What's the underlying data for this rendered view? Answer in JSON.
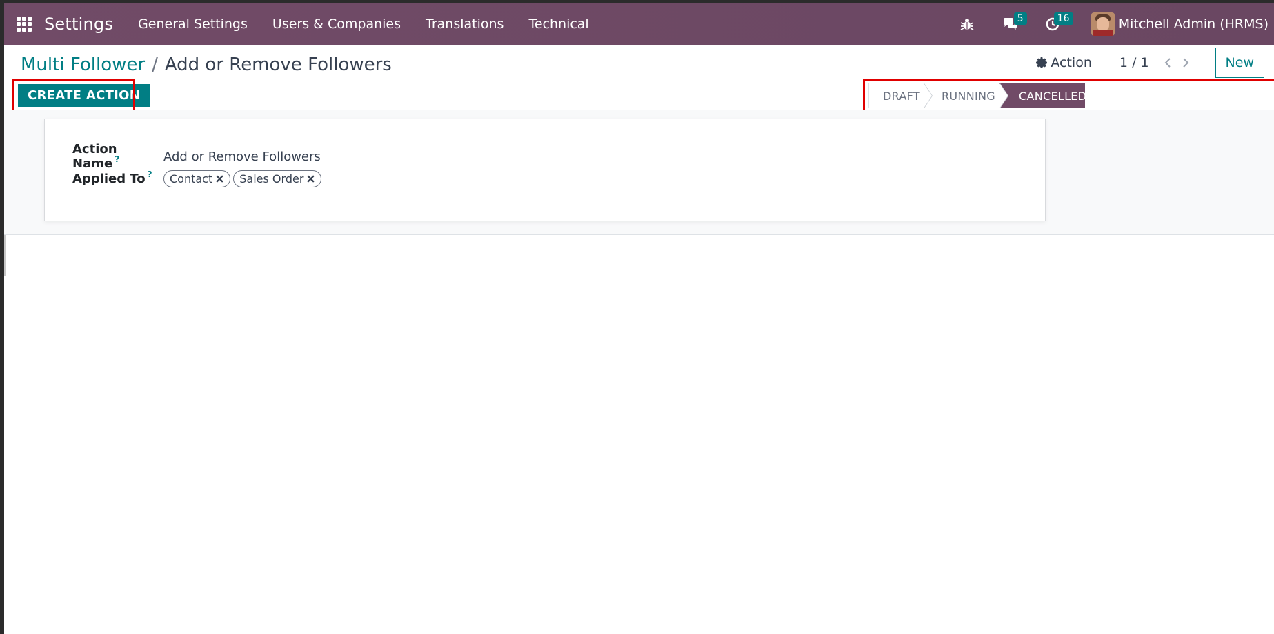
{
  "navbar": {
    "app_name": "Settings",
    "menu": [
      "General Settings",
      "Users & Companies",
      "Translations",
      "Technical"
    ],
    "messages_count": "5",
    "activities_count": "16",
    "user_name": "Mitchell Admin (HRMS)"
  },
  "breadcrumb": {
    "parent": "Multi Follower",
    "separator": "/",
    "current": "Add or Remove Followers"
  },
  "control": {
    "action_label": "Action",
    "pager": "1 / 1",
    "new_label": "New"
  },
  "statusbar": {
    "create_action_label": "CREATE ACTION",
    "stages": [
      "DRAFT",
      "RUNNING",
      "CANCELLED"
    ],
    "active_stage": "CANCELLED"
  },
  "form": {
    "action_name_label": "Action Name",
    "action_name_value": "Add or Remove Followers",
    "applied_to_label": "Applied To",
    "help_mark": "?",
    "applied_to_tags": [
      "Contact",
      "Sales Order"
    ]
  },
  "colors": {
    "navbar": "#714b67",
    "primary": "#017e84",
    "highlight": "#e00000"
  }
}
